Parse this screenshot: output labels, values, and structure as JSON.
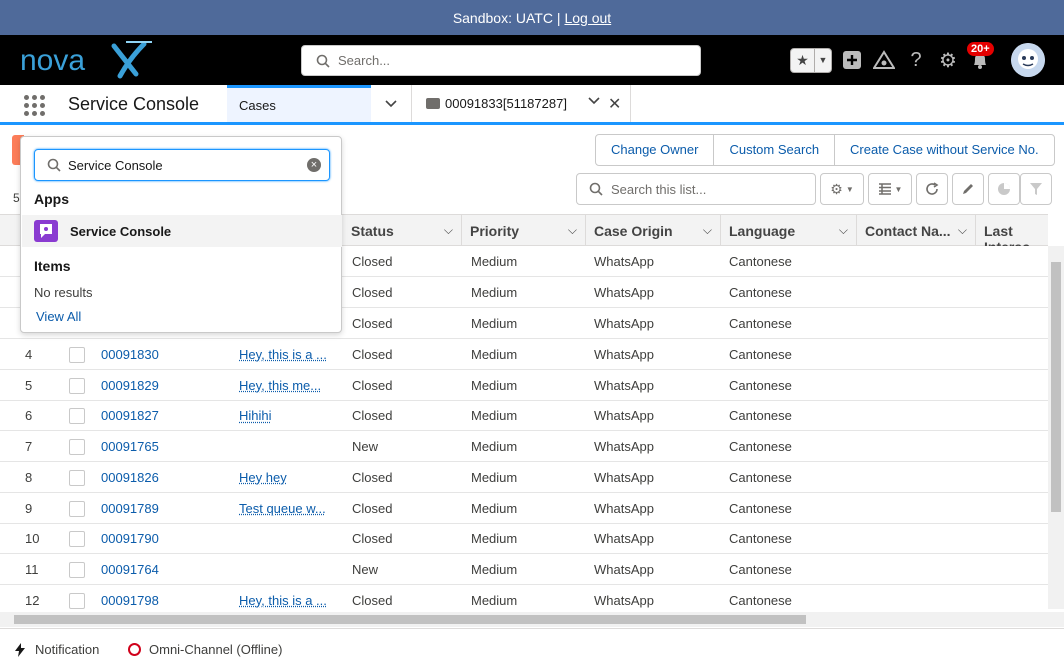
{
  "sandbox": {
    "label": "Sandbox: UATC |",
    "logout": "Log out"
  },
  "header": {
    "search_placeholder": "Search...",
    "notification_count": "20+"
  },
  "nav": {
    "app_name": "Service Console",
    "tabs": [
      {
        "label": "Cases"
      },
      {
        "label": "00091833[51187287]"
      }
    ]
  },
  "actions": {
    "change_owner": "Change Owner",
    "custom_search": "Custom Search",
    "create_case": "Create Case without Service No."
  },
  "list": {
    "search_placeholder": "Search this list...",
    "count_prefix": "5",
    "columns": [
      "Status",
      "Priority",
      "Case Origin",
      "Language",
      "Contact Na...",
      "Last Interac..."
    ],
    "rows": [
      {
        "num": "",
        "case": "",
        "subject": "",
        "status": "Closed",
        "priority": "Medium",
        "origin": "WhatsApp",
        "language": "Cantonese"
      },
      {
        "num": "",
        "case": "",
        "subject": "",
        "status": "Closed",
        "priority": "Medium",
        "origin": "WhatsApp",
        "language": "Cantonese"
      },
      {
        "num": "",
        "case": "",
        "subject": "",
        "status": "Closed",
        "priority": "Medium",
        "origin": "WhatsApp",
        "language": "Cantonese"
      },
      {
        "num": "4",
        "case": "00091830",
        "subject": "Hey, this is a ...",
        "status": "Closed",
        "priority": "Medium",
        "origin": "WhatsApp",
        "language": "Cantonese"
      },
      {
        "num": "5",
        "case": "00091829",
        "subject": "Hey, this me...",
        "status": "Closed",
        "priority": "Medium",
        "origin": "WhatsApp",
        "language": "Cantonese"
      },
      {
        "num": "6",
        "case": "00091827",
        "subject": "Hihihi",
        "status": "Closed",
        "priority": "Medium",
        "origin": "WhatsApp",
        "language": "Cantonese"
      },
      {
        "num": "7",
        "case": "00091765",
        "subject": "",
        "status": "New",
        "priority": "Medium",
        "origin": "WhatsApp",
        "language": "Cantonese"
      },
      {
        "num": "8",
        "case": "00091826",
        "subject": "Hey hey",
        "status": "Closed",
        "priority": "Medium",
        "origin": "WhatsApp",
        "language": "Cantonese"
      },
      {
        "num": "9",
        "case": "00091789",
        "subject": "Test queue w...",
        "status": "Closed",
        "priority": "Medium",
        "origin": "WhatsApp",
        "language": "Cantonese"
      },
      {
        "num": "10",
        "case": "00091790",
        "subject": "",
        "status": "Closed",
        "priority": "Medium",
        "origin": "WhatsApp",
        "language": "Cantonese"
      },
      {
        "num": "11",
        "case": "00091764",
        "subject": "",
        "status": "New",
        "priority": "Medium",
        "origin": "WhatsApp",
        "language": "Cantonese"
      },
      {
        "num": "12",
        "case": "00091798",
        "subject": "Hey, this is a ...",
        "status": "Closed",
        "priority": "Medium",
        "origin": "WhatsApp",
        "language": "Cantonese"
      }
    ]
  },
  "app_launcher": {
    "search_value": "Service Console",
    "apps_heading": "Apps",
    "app_result": "Service Console",
    "items_heading": "Items",
    "no_results": "No results",
    "view_all": "View All"
  },
  "footer": {
    "notification": "Notification",
    "omni": "Omni-Channel (Offline)"
  }
}
